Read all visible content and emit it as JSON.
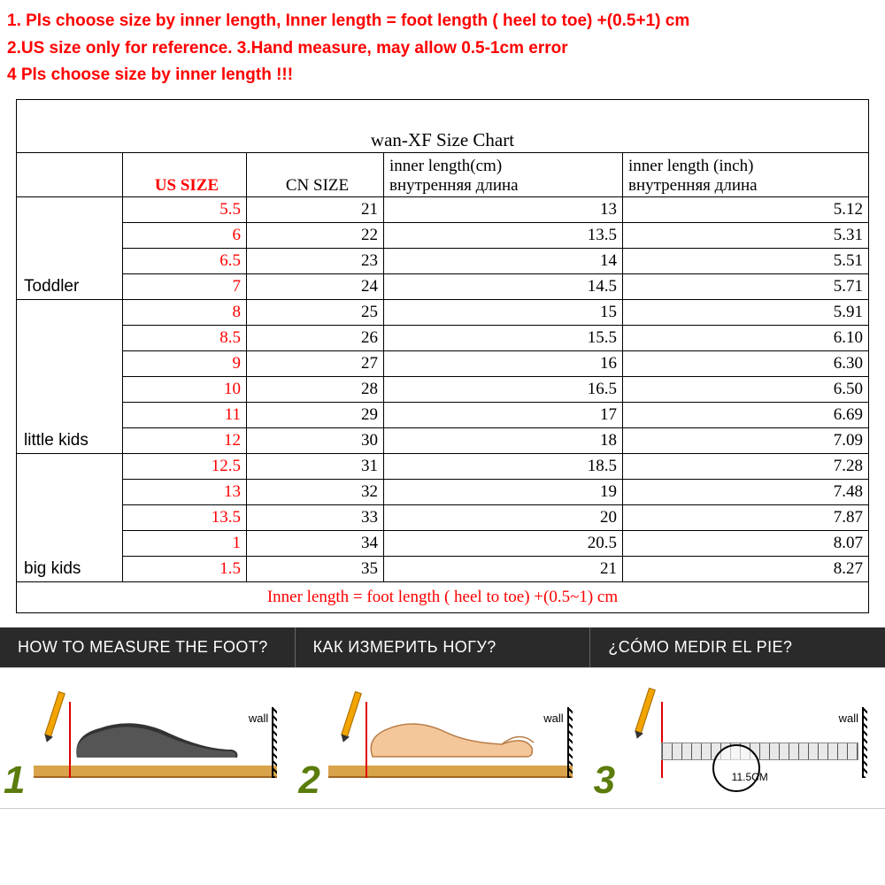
{
  "instructions": {
    "line1": "1. Pls choose size by inner length,   Inner length = foot length ( heel to toe)  +(0.5+1) cm",
    "line2": "2.US size only for reference.      3.Hand measure, may allow 0.5-1cm error",
    "line3": "4  Pls choose size by inner length !!!"
  },
  "chart_data": {
    "type": "table",
    "title": "wan-XF     Size  Chart",
    "columns": {
      "category": "",
      "us_size": "US  SIZE",
      "cn_size": "CN  SIZE",
      "inner_cm": "inner length(cm)",
      "inner_cm_sub": "внутренняя длина",
      "inner_in": "inner length (inch)",
      "inner_in_sub": "внутренняя длина"
    },
    "groups": [
      {
        "name": "Toddler",
        "rows": [
          {
            "us": "5.5",
            "cn": "21",
            "cm": "13",
            "in": "5.12"
          },
          {
            "us": "6",
            "cn": "22",
            "cm": "13.5",
            "in": "5.31"
          },
          {
            "us": "6.5",
            "cn": "23",
            "cm": "14",
            "in": "5.51"
          },
          {
            "us": "7",
            "cn": "24",
            "cm": "14.5",
            "in": "5.71"
          }
        ]
      },
      {
        "name": "little kids",
        "rows": [
          {
            "us": "8",
            "cn": "25",
            "cm": "15",
            "in": "5.91"
          },
          {
            "us": "8.5",
            "cn": "26",
            "cm": "15.5",
            "in": "6.10"
          },
          {
            "us": "9",
            "cn": "27",
            "cm": "16",
            "in": "6.30"
          },
          {
            "us": "10",
            "cn": "28",
            "cm": "16.5",
            "in": "6.50"
          },
          {
            "us": "11",
            "cn": "29",
            "cm": "17",
            "in": "6.69"
          },
          {
            "us": "12",
            "cn": "30",
            "cm": "18",
            "in": "7.09"
          }
        ]
      },
      {
        "name": "big kids",
        "rows": [
          {
            "us": "12.5",
            "cn": "31",
            "cm": "18.5",
            "in": "7.28"
          },
          {
            "us": "13",
            "cn": "32",
            "cm": "19",
            "in": "7.48"
          },
          {
            "us": "13.5",
            "cn": "33",
            "cm": "20",
            "in": "7.87"
          },
          {
            "us": "1",
            "cn": "34",
            "cm": "20.5",
            "in": "8.07"
          },
          {
            "us": "1.5",
            "cn": "35",
            "cm": "21",
            "in": "8.27"
          }
        ]
      }
    ],
    "footer_formula": "Inner length = foot length ( heel to toe)  +(0.5~1) cm"
  },
  "measure": {
    "q_en": "HOW TO MEASURE THE FOOT?",
    "q_ru": "КАК ИЗМЕРИТЬ НОГУ?",
    "q_es": "¿CÓMO MEDIR EL PIE?",
    "wall_label": "wall",
    "step1": "1",
    "step2": "2",
    "step3": "3",
    "ruler_reading": "11.5CM"
  }
}
